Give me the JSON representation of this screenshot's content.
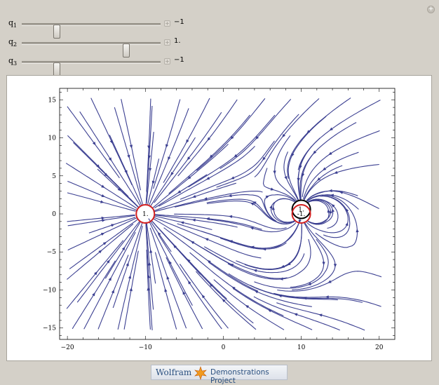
{
  "controls": [
    {
      "name": "q",
      "sub": "1",
      "value": "−1",
      "fraction": 0.25
    },
    {
      "name": "q",
      "sub": "2",
      "value": "1.",
      "fraction": 0.75
    },
    {
      "name": "q",
      "sub": "3",
      "value": "−1",
      "fraction": 0.25
    }
  ],
  "slider_plus_symbol": "+",
  "corner_symbol": "+",
  "plot": {
    "x_ticks": [
      "−20",
      "−10",
      "0",
      "10",
      "20"
    ],
    "x_tick_values": [
      -20,
      -10,
      0,
      10,
      20
    ],
    "y_ticks": [
      "15",
      "10",
      "5",
      "0",
      "−5",
      "−10",
      "−15"
    ],
    "y_tick_values": [
      15,
      10,
      5,
      0,
      -5,
      -10,
      -15
    ],
    "xlim": [
      -21,
      22
    ],
    "ylim": [
      -16.5,
      16.5
    ],
    "line_color": "#3b3f91",
    "charges": [
      {
        "x": -10,
        "y": 0,
        "label": "1.",
        "color": "#d42020"
      },
      {
        "x": 10,
        "y": 0.6,
        "label": "1.",
        "color": "#000000"
      },
      {
        "x": 10,
        "y": 0,
        "label": "-1.",
        "color": "#d42020"
      }
    ]
  },
  "footer": {
    "brand": "Wolfram",
    "project": "Demonstrations Project"
  }
}
